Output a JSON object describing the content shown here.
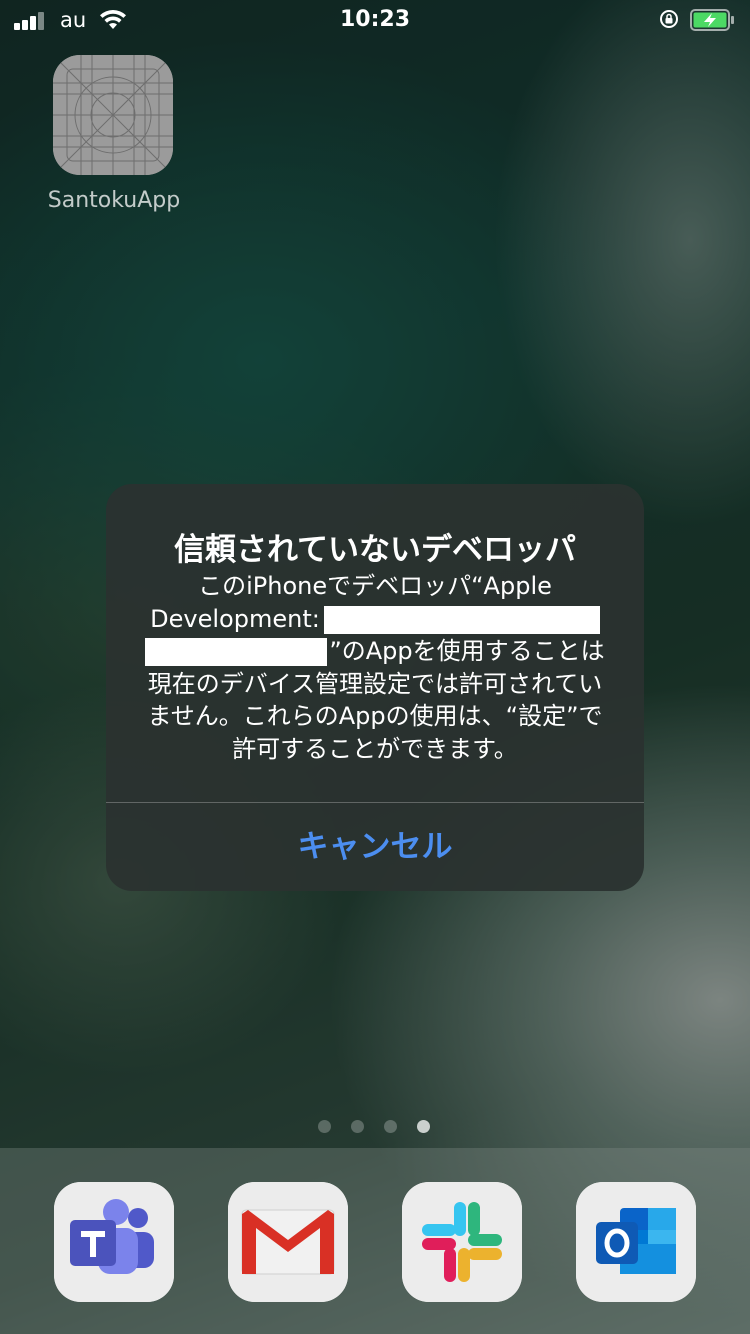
{
  "status_bar": {
    "carrier": "au",
    "time": "10:23",
    "icons": [
      "signal-icon",
      "wifi-icon",
      "orientation-lock-icon",
      "battery-charging-icon"
    ],
    "battery_color": "#4cd964"
  },
  "home": {
    "app_label": "SantokuApp",
    "app_icon": "placeholder-app-icon",
    "page_count": 4,
    "current_page": 4
  },
  "dock": {
    "apps": [
      "microsoft-teams-icon",
      "gmail-icon",
      "slack-icon",
      "microsoft-outlook-icon"
    ]
  },
  "alert": {
    "title": "信頼されていないデベロッパ",
    "message_line1": "このiPhoneでデベロッパ“Apple",
    "message_line2_prefix": "Development:",
    "message_line3_suffix": "”のAppを使用することは",
    "message_line4": "現在のデバイス管理設定では許可されてい",
    "message_line5": "ません。これらのAppの使用は、“設定”で",
    "message_line6": "許可することができます。",
    "cancel_label": "キャンセル",
    "accent_color": "#4c8ef0"
  }
}
